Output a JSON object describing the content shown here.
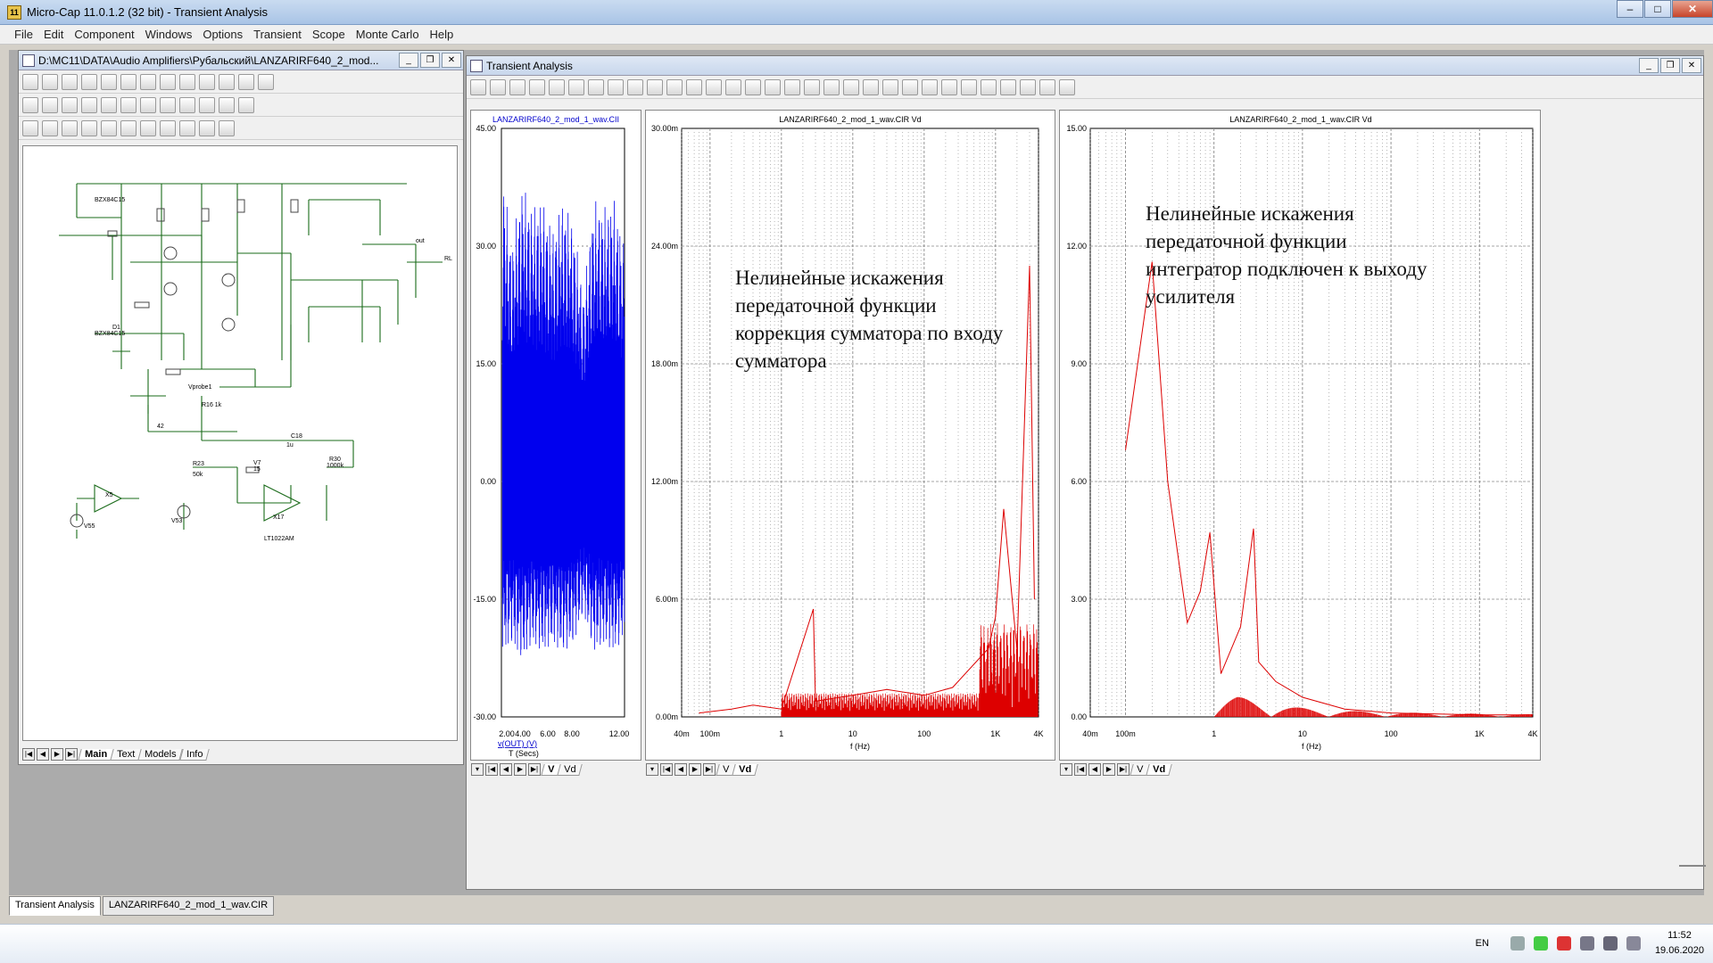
{
  "window": {
    "title": "Micro-Cap 11.0.1.2 (32 bit) - Transient Analysis",
    "app_icon": "11"
  },
  "menu": [
    "File",
    "Edit",
    "Component",
    "Windows",
    "Options",
    "Transient",
    "Scope",
    "Monte Carlo",
    "Help"
  ],
  "schematic_window": {
    "title": "D:\\MC11\\DATA\\Audio Amplifiers\\Рубальский\\LANZARIRF640_2_mod...",
    "tabs": [
      "Main",
      "Text",
      "Models",
      "Info"
    ],
    "active_tab": "Main",
    "labels": {
      "opamp": "LT1022AM",
      "c18": "C18",
      "tu": "1u",
      "r30": "R30",
      "r30v": "1000k",
      "v7": "V7",
      "v7v": "15",
      "x17": "X17",
      "r23": "R23",
      "r23v": "50k",
      "r16": "R16 1k",
      "x5": "X5",
      "v55": "V55",
      "v53": "V53",
      "vout": "out",
      "rl": "RL",
      "d1": "D1",
      "bzx1": "BZX84C15",
      "bzx2": "BZX84C15",
      "probe": "Vprobe1",
      "r42": "42"
    }
  },
  "analysis_window": {
    "title": "Transient Analysis",
    "panes": [
      {
        "id": "time",
        "title": "LANZARIRF640_2_mod_1_wav.CII",
        "y_ticks": [
          "45.00",
          "30.00",
          "15.00",
          "0.00",
          "-15.00",
          "-30.00"
        ],
        "x_ticks": [
          "2.00",
          "4.00",
          "6.00",
          "8.00",
          "12.00"
        ],
        "x_label": "v(OUT) (V)",
        "x_unit": "T (Secs)",
        "tabs": [
          "V",
          "Vd"
        ],
        "active_tab": "V"
      },
      {
        "id": "fft1",
        "title": "LANZARIRF640_2_mod_1_wav.CIR Vd",
        "y_ticks": [
          "30.00m",
          "24.00m",
          "18.00m",
          "12.00m",
          "6.00m",
          "0.00m"
        ],
        "x_ticks": [
          "40m",
          "100m",
          "1",
          "10",
          "100",
          "1K",
          "4K"
        ],
        "x_label": "f (Hz)",
        "note": [
          "Нелинейные искажения",
          "передаточной функции",
          "коррекция сумматора по входу",
          "сумматора"
        ],
        "tabs": [
          "V",
          "Vd"
        ],
        "active_tab": "Vd"
      },
      {
        "id": "fft2",
        "title": "LANZARIRF640_2_mod_1_wav.CIR Vd",
        "y_ticks": [
          "15.00",
          "12.00",
          "9.00",
          "6.00",
          "3.00",
          "0.00"
        ],
        "x_ticks": [
          "40m",
          "100m",
          "1",
          "10",
          "100",
          "1K",
          "4K"
        ],
        "x_label": "f (Hz)",
        "note": [
          "Нелинейные искажения",
          "передаточной функции",
          "интегратор подключен к выходу",
          "усилителя"
        ],
        "tabs": [
          "V",
          "Vd"
        ],
        "active_tab": "Vd"
      }
    ]
  },
  "doc_tabs": [
    "Transient Analysis",
    "LANZARIRF640_2_mod_1_wav.CIR"
  ],
  "taskbar": {
    "lang": "EN",
    "time": "11:52",
    "date": "19.06.2020"
  },
  "colors": {
    "time_trace": "#0000ee",
    "fft_trace": "#dd0000",
    "wire": "#1a6b1a",
    "grid": "#888888"
  },
  "chart_data": [
    {
      "type": "line",
      "title": "LANZARIRF640_2_mod_1_wav.CII",
      "xlabel": "T (Secs)",
      "ylabel": "v(OUT) (V)",
      "xlim": [
        0,
        12
      ],
      "ylim": [
        -30,
        45
      ],
      "series": [
        {
          "name": "v(OUT) (V)",
          "x": [
            0.1,
            1,
            2,
            3,
            4,
            5,
            6,
            7,
            8,
            9,
            10,
            11,
            12
          ],
          "y_max": [
            40,
            30,
            38,
            35,
            36,
            32,
            36,
            33,
            24,
            36,
            35,
            36,
            30
          ],
          "y_min": [
            -22,
            -21,
            -23,
            -21,
            -22,
            -21,
            -22,
            -21,
            -17,
            -22,
            -21,
            -22,
            -20
          ]
        }
      ]
    },
    {
      "type": "line",
      "title": "LANZARIRF640_2_mod_1_wav.CIR Vd",
      "xlabel": "f (Hz)",
      "xscale": "log",
      "xlim": [
        0.04,
        4000
      ],
      "ylim": [
        0,
        0.03
      ],
      "series": [
        {
          "name": "",
          "x": [
            0.07,
            0.2,
            0.4,
            1,
            2.8,
            3,
            10,
            30,
            100,
            250,
            800,
            1000,
            1300,
            2000,
            3000,
            3500
          ],
          "y": [
            0.0002,
            0.0004,
            0.0006,
            0.0004,
            0.0055,
            0.0008,
            0.0011,
            0.0014,
            0.0011,
            0.0015,
            0.0035,
            0.0051,
            0.0106,
            0.0034,
            0.023,
            0.006
          ]
        }
      ]
    },
    {
      "type": "line",
      "title": "LANZARIRF640_2_mod_1_wav.CIR Vd",
      "xlabel": "f (Hz)",
      "xscale": "log",
      "xlim": [
        0.04,
        4000
      ],
      "ylim": [
        0,
        15
      ],
      "series": [
        {
          "name": "",
          "x": [
            0.1,
            0.2,
            0.3,
            0.5,
            0.7,
            0.9,
            1.2,
            2,
            2.8,
            3.2,
            5,
            10,
            30,
            100,
            1000,
            4000
          ],
          "y": [
            6.8,
            11.6,
            6.0,
            2.4,
            3.2,
            4.7,
            1.1,
            2.3,
            4.8,
            1.4,
            0.9,
            0.5,
            0.2,
            0.1,
            0.05,
            0.05
          ]
        }
      ]
    }
  ]
}
